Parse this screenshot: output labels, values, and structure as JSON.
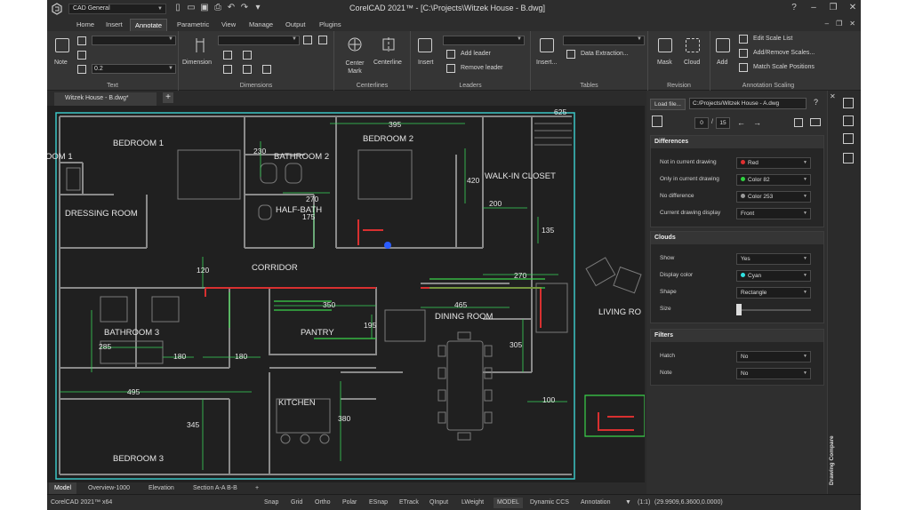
{
  "titlebar": {
    "workspace": "CAD General",
    "title": "CorelCAD 2021™ - [C:\\Projects\\Witzek House - B.dwg]"
  },
  "menu": {
    "tabs": [
      "Home",
      "Insert",
      "Annotate",
      "Parametric",
      "View",
      "Manage",
      "Output",
      "Plugins"
    ],
    "active": "Annotate"
  },
  "ribbon": {
    "text_group": {
      "label": "Text",
      "note_label": "Note",
      "text_height": "0.2"
    },
    "dimensions_group": {
      "label": "Dimensions",
      "dimension_label": "Dimension"
    },
    "centerlines_group": {
      "label": "Centerlines",
      "center_mark_label": "Center Mark",
      "centerline_label": "Centerline"
    },
    "leaders_group": {
      "label": "Leaders",
      "insert_label": "Insert",
      "add_leader_label": "Add leader",
      "remove_leader_label": "Remove leader"
    },
    "tables_group": {
      "label": "Tables",
      "insert_label": "Insert...",
      "data_extraction_label": "Data Extraction..."
    },
    "revision_group": {
      "label": "Revision",
      "mask_label": "Mask",
      "cloud_label": "Cloud"
    },
    "annotation_scaling_group": {
      "label": "Annotation Scaling",
      "add_label": "Add",
      "edit_scale_list_label": "Edit Scale List",
      "add_remove_scales_label": "Add/Remove Scales...",
      "match_scale_positions_label": "Match Scale Positions"
    }
  },
  "document_tab": {
    "name": "Witzek House - B.dwg*"
  },
  "drawing": {
    "rooms": [
      "BEDROOM 1",
      "OOM 1",
      "DRESSING ROOM",
      "BATHROOM 2",
      "HALF-BATH",
      "BEDROOM 2",
      "WALK-IN CLOSET",
      "CORRIDOR",
      "PANTRY",
      "DINING ROOM",
      "LIVING RO",
      "BATHROOM 3",
      "KITCHEN",
      "BEDROOM 3"
    ],
    "dimensions": [
      "395",
      "625",
      "230",
      "270",
      "175",
      "420",
      "200",
      "135",
      "120",
      "270",
      "350",
      "465",
      "195",
      "305",
      "285",
      "180",
      "180",
      "495",
      "380",
      "345",
      "100"
    ]
  },
  "layout_tabs": [
    "Model",
    "Overview-1000",
    "Elevation",
    "Section A-A B-B"
  ],
  "status": {
    "app": "CorelCAD 2021™ x64",
    "toggles": [
      "Snap",
      "Grid",
      "Ortho",
      "Polar",
      "ESnap",
      "ETrack",
      "QInput",
      "LWeight",
      "MODEL",
      "Dynamic CCS",
      "Annotation"
    ],
    "scale": "(1:1)",
    "coords": "(29.9909,6.3600,0.0000)"
  },
  "panel": {
    "load_file_label": "Load file...",
    "file_path": "C:/Projects/Witzek House - A.dwg",
    "page_current": "0",
    "page_total": "15",
    "side_title": "Drawing Compare",
    "differences": {
      "title": "Differences",
      "rows": [
        {
          "label": "Not in current drawing",
          "value": "Red",
          "color": "#e03030"
        },
        {
          "label": "Only in current drawing",
          "value": "Color 82",
          "color": "#30d040"
        },
        {
          "label": "No difference",
          "value": "Color 253",
          "color": "#9a9a9a"
        },
        {
          "label": "Current drawing display",
          "value": "Front",
          "color": ""
        }
      ]
    },
    "clouds": {
      "title": "Clouds",
      "rows": [
        {
          "label": "Show",
          "value": "Yes"
        },
        {
          "label": "Display color",
          "value": "Cyan",
          "color": "#30e0e0"
        },
        {
          "label": "Shape",
          "value": "Rectangle"
        }
      ],
      "size_label": "Size"
    },
    "filters": {
      "title": "Filters",
      "rows": [
        {
          "label": "Hatch",
          "value": "No"
        },
        {
          "label": "Note",
          "value": "No"
        }
      ]
    }
  }
}
